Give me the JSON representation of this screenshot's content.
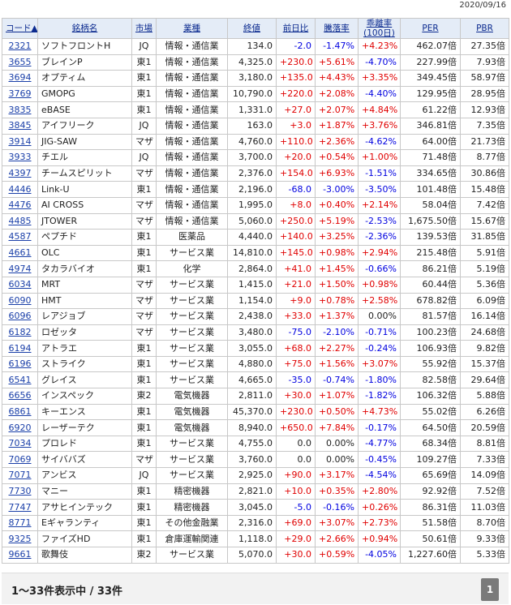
{
  "date": "2020/09/16",
  "headers": {
    "code": "コード▲",
    "name": "銘柄名",
    "market": "市場",
    "sector": "業種",
    "price": "終値",
    "change": "前日比",
    "change_pct": "騰落率",
    "deviation_line1": "乖離率",
    "deviation_line2": "(100日)",
    "per": "PER",
    "pbr": "PBR"
  },
  "rows": [
    {
      "code": "2321",
      "name": "ソフトフロントH",
      "market": "JQ",
      "sector": "情報・通信業",
      "price": "134.0",
      "change": "-2.0",
      "change_pct": "-1.47%",
      "deviation": "+4.23%",
      "per": "462.07倍",
      "pbr": "27.35倍"
    },
    {
      "code": "3655",
      "name": "ブレインP",
      "market": "東1",
      "sector": "情報・通信業",
      "price": "4,325.0",
      "change": "+230.0",
      "change_pct": "+5.61%",
      "deviation": "-4.70%",
      "per": "227.99倍",
      "pbr": "7.93倍"
    },
    {
      "code": "3694",
      "name": "オプティム",
      "market": "東1",
      "sector": "情報・通信業",
      "price": "3,180.0",
      "change": "+135.0",
      "change_pct": "+4.43%",
      "deviation": "+3.35%",
      "per": "349.45倍",
      "pbr": "58.97倍"
    },
    {
      "code": "3769",
      "name": "GMOPG",
      "market": "東1",
      "sector": "情報・通信業",
      "price": "10,790.0",
      "change": "+220.0",
      "change_pct": "+2.08%",
      "deviation": "-4.40%",
      "per": "129.95倍",
      "pbr": "28.95倍"
    },
    {
      "code": "3835",
      "name": "eBASE",
      "market": "東1",
      "sector": "情報・通信業",
      "price": "1,331.0",
      "change": "+27.0",
      "change_pct": "+2.07%",
      "deviation": "+4.84%",
      "per": "61.22倍",
      "pbr": "12.93倍"
    },
    {
      "code": "3845",
      "name": "アイフリーク",
      "market": "JQ",
      "sector": "情報・通信業",
      "price": "163.0",
      "change": "+3.0",
      "change_pct": "+1.87%",
      "deviation": "+3.76%",
      "per": "346.81倍",
      "pbr": "7.35倍"
    },
    {
      "code": "3914",
      "name": "JIG-SAW",
      "market": "マザ",
      "sector": "情報・通信業",
      "price": "4,760.0",
      "change": "+110.0",
      "change_pct": "+2.36%",
      "deviation": "-4.62%",
      "per": "64.00倍",
      "pbr": "21.73倍"
    },
    {
      "code": "3933",
      "name": "チエル",
      "market": "JQ",
      "sector": "情報・通信業",
      "price": "3,700.0",
      "change": "+20.0",
      "change_pct": "+0.54%",
      "deviation": "+1.00%",
      "per": "71.48倍",
      "pbr": "8.77倍"
    },
    {
      "code": "4397",
      "name": "チームスピリット",
      "market": "マザ",
      "sector": "情報・通信業",
      "price": "2,376.0",
      "change": "+154.0",
      "change_pct": "+6.93%",
      "deviation": "-1.51%",
      "per": "334.65倍",
      "pbr": "30.86倍"
    },
    {
      "code": "4446",
      "name": "Link-U",
      "market": "東1",
      "sector": "情報・通信業",
      "price": "2,196.0",
      "change": "-68.0",
      "change_pct": "-3.00%",
      "deviation": "-3.50%",
      "per": "101.48倍",
      "pbr": "15.48倍"
    },
    {
      "code": "4476",
      "name": "AI CROSS",
      "market": "マザ",
      "sector": "情報・通信業",
      "price": "1,995.0",
      "change": "+8.0",
      "change_pct": "+0.40%",
      "deviation": "+2.14%",
      "per": "58.04倍",
      "pbr": "7.42倍"
    },
    {
      "code": "4485",
      "name": "JTOWER",
      "market": "マザ",
      "sector": "情報・通信業",
      "price": "5,060.0",
      "change": "+250.0",
      "change_pct": "+5.19%",
      "deviation": "-2.53%",
      "per": "1,675.50倍",
      "pbr": "15.67倍"
    },
    {
      "code": "4587",
      "name": "ペプチド",
      "market": "東1",
      "sector": "医薬品",
      "price": "4,440.0",
      "change": "+140.0",
      "change_pct": "+3.25%",
      "deviation": "-2.36%",
      "per": "139.53倍",
      "pbr": "31.85倍"
    },
    {
      "code": "4661",
      "name": "OLC",
      "market": "東1",
      "sector": "サービス業",
      "price": "14,810.0",
      "change": "+145.0",
      "change_pct": "+0.98%",
      "deviation": "+2.94%",
      "per": "215.48倍",
      "pbr": "5.91倍"
    },
    {
      "code": "4974",
      "name": "タカラバイオ",
      "market": "東1",
      "sector": "化学",
      "price": "2,864.0",
      "change": "+41.0",
      "change_pct": "+1.45%",
      "deviation": "-0.66%",
      "per": "86.21倍",
      "pbr": "5.19倍"
    },
    {
      "code": "6034",
      "name": "MRT",
      "market": "マザ",
      "sector": "サービス業",
      "price": "1,415.0",
      "change": "+21.0",
      "change_pct": "+1.50%",
      "deviation": "+0.98%",
      "per": "60.44倍",
      "pbr": "5.36倍"
    },
    {
      "code": "6090",
      "name": "HMT",
      "market": "マザ",
      "sector": "サービス業",
      "price": "1,154.0",
      "change": "+9.0",
      "change_pct": "+0.78%",
      "deviation": "+2.58%",
      "per": "678.82倍",
      "pbr": "6.09倍"
    },
    {
      "code": "6096",
      "name": "レアジョブ",
      "market": "マザ",
      "sector": "サービス業",
      "price": "2,438.0",
      "change": "+33.0",
      "change_pct": "+1.37%",
      "deviation": "0.00%",
      "per": "81.57倍",
      "pbr": "16.14倍"
    },
    {
      "code": "6182",
      "name": "ロゼッタ",
      "market": "マザ",
      "sector": "サービス業",
      "price": "3,480.0",
      "change": "-75.0",
      "change_pct": "-2.10%",
      "deviation": "-0.71%",
      "per": "100.23倍",
      "pbr": "24.68倍"
    },
    {
      "code": "6194",
      "name": "アトラエ",
      "market": "東1",
      "sector": "サービス業",
      "price": "3,055.0",
      "change": "+68.0",
      "change_pct": "+2.27%",
      "deviation": "-0.24%",
      "per": "106.93倍",
      "pbr": "9.82倍"
    },
    {
      "code": "6196",
      "name": "ストライク",
      "market": "東1",
      "sector": "サービス業",
      "price": "4,880.0",
      "change": "+75.0",
      "change_pct": "+1.56%",
      "deviation": "+3.07%",
      "per": "55.92倍",
      "pbr": "15.37倍"
    },
    {
      "code": "6541",
      "name": "グレイス",
      "market": "東1",
      "sector": "サービス業",
      "price": "4,665.0",
      "change": "-35.0",
      "change_pct": "-0.74%",
      "deviation": "-1.80%",
      "per": "82.58倍",
      "pbr": "29.64倍"
    },
    {
      "code": "6656",
      "name": "インスペック",
      "market": "東2",
      "sector": "電気機器",
      "price": "2,811.0",
      "change": "+30.0",
      "change_pct": "+1.07%",
      "deviation": "-1.82%",
      "per": "106.32倍",
      "pbr": "5.88倍"
    },
    {
      "code": "6861",
      "name": "キーエンス",
      "market": "東1",
      "sector": "電気機器",
      "price": "45,370.0",
      "change": "+230.0",
      "change_pct": "+0.50%",
      "deviation": "+4.73%",
      "per": "55.02倍",
      "pbr": "6.26倍"
    },
    {
      "code": "6920",
      "name": "レーザーテク",
      "market": "東1",
      "sector": "電気機器",
      "price": "8,940.0",
      "change": "+650.0",
      "change_pct": "+7.84%",
      "deviation": "-0.17%",
      "per": "64.50倍",
      "pbr": "20.59倍"
    },
    {
      "code": "7034",
      "name": "プロレド",
      "market": "東1",
      "sector": "サービス業",
      "price": "4,755.0",
      "change": "0.0",
      "change_pct": "0.00%",
      "deviation": "-4.77%",
      "per": "68.34倍",
      "pbr": "8.81倍"
    },
    {
      "code": "7069",
      "name": "サイババズ",
      "market": "マザ",
      "sector": "サービス業",
      "price": "3,760.0",
      "change": "0.0",
      "change_pct": "0.00%",
      "deviation": "-0.45%",
      "per": "109.27倍",
      "pbr": "7.33倍"
    },
    {
      "code": "7071",
      "name": "アンビス",
      "market": "JQ",
      "sector": "サービス業",
      "price": "2,925.0",
      "change": "+90.0",
      "change_pct": "+3.17%",
      "deviation": "-4.54%",
      "per": "65.69倍",
      "pbr": "14.09倍"
    },
    {
      "code": "7730",
      "name": "マニー",
      "market": "東1",
      "sector": "精密機器",
      "price": "2,821.0",
      "change": "+10.0",
      "change_pct": "+0.35%",
      "deviation": "+2.80%",
      "per": "92.92倍",
      "pbr": "7.52倍"
    },
    {
      "code": "7747",
      "name": "アサヒインテック",
      "market": "東1",
      "sector": "精密機器",
      "price": "3,045.0",
      "change": "-5.0",
      "change_pct": "-0.16%",
      "deviation": "+0.26%",
      "per": "86.31倍",
      "pbr": "11.03倍"
    },
    {
      "code": "8771",
      "name": "Eギャランティ",
      "market": "東1",
      "sector": "その他金融業",
      "price": "2,316.0",
      "change": "+69.0",
      "change_pct": "+3.07%",
      "deviation": "+2.73%",
      "per": "51.58倍",
      "pbr": "8.70倍"
    },
    {
      "code": "9325",
      "name": "ファイズHD",
      "market": "東1",
      "sector": "倉庫運輸関連",
      "price": "1,118.0",
      "change": "+29.0",
      "change_pct": "+2.66%",
      "deviation": "+0.94%",
      "per": "50.61倍",
      "pbr": "9.33倍"
    },
    {
      "code": "9661",
      "name": "歌舞伎",
      "market": "東2",
      "sector": "サービス業",
      "price": "5,070.0",
      "change": "+30.0",
      "change_pct": "+0.59%",
      "deviation": "-4.05%",
      "per": "1,227.60倍",
      "pbr": "5.33倍"
    }
  ],
  "footer": {
    "count_text": "1〜33件表示中 / 33件",
    "page": "1"
  },
  "colors": {
    "positive": "#e00000",
    "negative": "#0000e0",
    "header_bg": "#e4ecf7",
    "link": "#1a3fa8"
  }
}
